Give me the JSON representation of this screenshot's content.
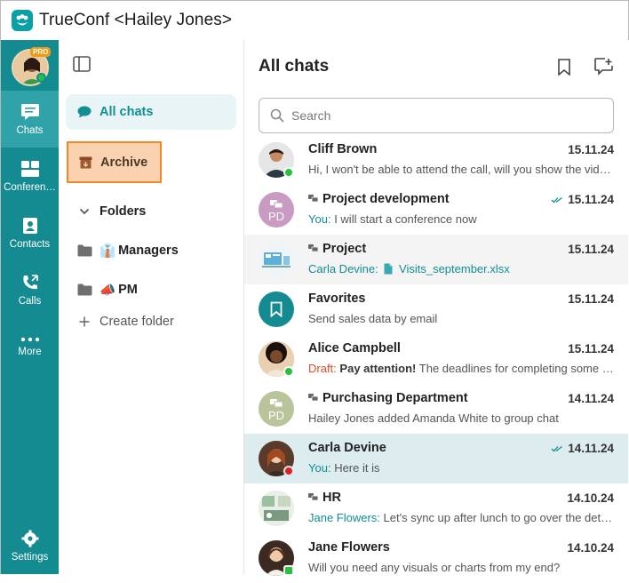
{
  "window": {
    "title": "TrueConf <Hailey Jones>"
  },
  "user": {
    "badge": "PRO"
  },
  "rail": {
    "items": [
      {
        "label": "Chats"
      },
      {
        "label": "Conferen…"
      },
      {
        "label": "Contacts"
      },
      {
        "label": "Calls"
      },
      {
        "label": "More"
      }
    ],
    "settings_label": "Settings"
  },
  "folders": {
    "all_chats": "All chats",
    "archive": "Archive",
    "folders_header": "Folders",
    "items": [
      {
        "emoji": "👔",
        "label": "Managers"
      },
      {
        "emoji": "📣",
        "label": "PM"
      }
    ],
    "create_folder": "Create folder"
  },
  "chat_list": {
    "title": "All chats",
    "search_placeholder": "Search",
    "chats": [
      {
        "name": "Cliff Brown",
        "date": "15.11.24",
        "preview": "Hi, I won't be able to attend the call, will you show the video …"
      },
      {
        "name": "Project development",
        "date": "15.11.24",
        "prefix": "You:",
        "preview": "I will start a conference now",
        "initials": "PD"
      },
      {
        "name": "Project",
        "date": "15.11.24",
        "prefix": "Carla Devine:",
        "preview": "Visits_september.xlsx"
      },
      {
        "name": "Favorites",
        "date": "15.11.24",
        "preview": "Send sales data by email"
      },
      {
        "name": "Alice Campbell",
        "date": "15.11.24",
        "prefix": "Draft:",
        "bold": "Pay attention!",
        "preview": "The deadlines for completing some ta…"
      },
      {
        "name": "Purchasing Department",
        "date": "14.11.24",
        "preview": "Hailey Jones added Amanda White to group chat",
        "initials": "PD"
      },
      {
        "name": "Carla Devine",
        "date": "14.11.24",
        "prefix": "You:",
        "preview": "Here it is"
      },
      {
        "name": "HR",
        "date": "14.10.24",
        "prefix": "Jane Flowers:",
        "preview": "Let's sync up after lunch to go over the detail…"
      },
      {
        "name": "Jane Flowers",
        "date": "14.10.24",
        "preview": "Will you need any visuals or charts from my end?"
      }
    ]
  },
  "colors": {
    "rail": "#138b90",
    "accent": "#128e94",
    "archive_highlight": "#fbd2b0",
    "archive_border": "#f08a28",
    "online": "#24c33b",
    "busy": "#e02020"
  }
}
